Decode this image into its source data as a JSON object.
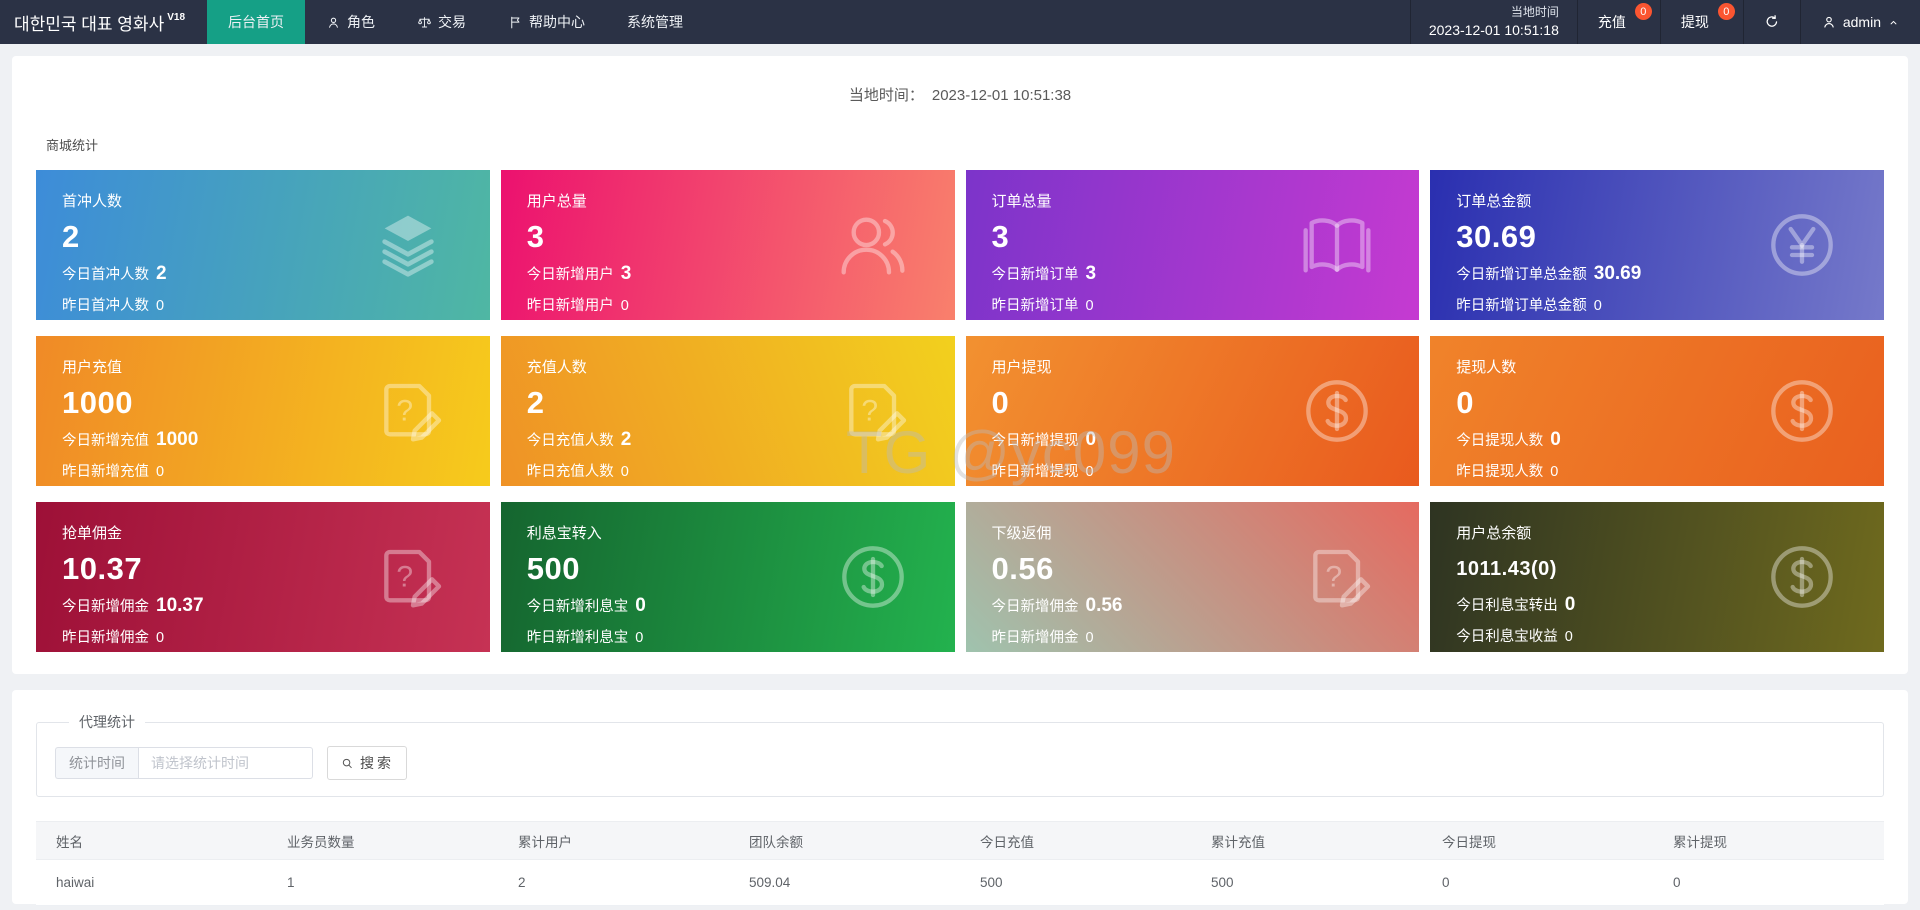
{
  "topbar": {
    "brand": "대한민국 대표 영화사",
    "brand_version": "V18",
    "nav": [
      {
        "label": "后台首页",
        "icon": "none",
        "active": true
      },
      {
        "label": "角色",
        "icon": "user",
        "active": false
      },
      {
        "label": "交易",
        "icon": "scales",
        "active": false
      },
      {
        "label": "帮助中心",
        "icon": "flag",
        "active": false
      },
      {
        "label": "系统管理",
        "icon": "none",
        "active": false
      }
    ],
    "local_time_label": "当地时间",
    "local_time_value": "2023-12-01 10:51:18",
    "recharge": {
      "label": "充值",
      "badge": "0"
    },
    "withdraw": {
      "label": "提现",
      "badge": "0"
    },
    "username": "admin"
  },
  "overview": {
    "time_label": "当地时间：",
    "time_value": "2023-12-01 10:51:38",
    "section_title": "商城统计",
    "watermark": "TG @yc099",
    "cards": [
      {
        "title": "首冲人数",
        "value": "2",
        "line2_label": "今日首冲人数",
        "line2_value": "2",
        "line3_label": "昨日首冲人数",
        "line3_value": "0",
        "icon": "layers",
        "angle": 100,
        "colors": [
          "#3d8cd9",
          "#4fb7a3"
        ]
      },
      {
        "title": "用户总量",
        "value": "3",
        "line2_label": "今日新增用户",
        "line2_value": "3",
        "line3_label": "昨日新增用户",
        "line3_value": "0",
        "icon": "users",
        "angle": 100,
        "colors": [
          "#ec116f",
          "#f9806c"
        ]
      },
      {
        "title": "订单总量",
        "value": "3",
        "line2_label": "今日新增订单",
        "line2_value": "3",
        "line3_label": "昨日新增订单",
        "line3_value": "0",
        "icon": "book",
        "angle": 100,
        "colors": [
          "#7c34ca",
          "#c53ad1"
        ]
      },
      {
        "title": "订单总金额",
        "value": "30.69",
        "line2_label": "今日新增订单总金额",
        "line2_value": "30.69",
        "line3_label": "昨日新增订单总金额",
        "line3_value": "0",
        "icon": "yen",
        "angle": 100,
        "colors": [
          "#2a2fb0",
          "#7579ca"
        ]
      },
      {
        "title": "用户充值",
        "value": "1000",
        "line2_label": "今日新增充值",
        "line2_value": "1000",
        "line3_label": "昨日新增充值",
        "line3_value": "0",
        "icon": "doc",
        "angle": 100,
        "colors": [
          "#f08a27",
          "#f6cb1c"
        ]
      },
      {
        "title": "充值人数",
        "value": "2",
        "line2_label": "今日充值人数",
        "line2_value": "2",
        "line3_label": "昨日充值人数",
        "line3_value": "0",
        "icon": "doc",
        "angle": 70,
        "colors": [
          "#ef9226",
          "#f2d01e"
        ]
      },
      {
        "title": "用户提现",
        "value": "0",
        "line2_label": "今日新增提现",
        "line2_value": "0",
        "line3_label": "昨日新增提现",
        "line3_value": "0",
        "icon": "dollar",
        "angle": 115,
        "colors": [
          "#f29130",
          "#e95a1e"
        ]
      },
      {
        "title": "提现人数",
        "value": "0",
        "line2_label": "今日提现人数",
        "line2_value": "0",
        "line3_label": "昨日提现人数",
        "line3_value": "0",
        "icon": "dollar",
        "angle": 115,
        "colors": [
          "#f0832a",
          "#e9601f"
        ]
      },
      {
        "title": "抢单佣金",
        "value": "10.37",
        "line2_label": "今日新增佣金",
        "line2_value": "10.37",
        "line3_label": "昨日新增佣金",
        "line3_value": "0",
        "icon": "doc",
        "angle": 100,
        "colors": [
          "#9d1037",
          "#c63254"
        ]
      },
      {
        "title": "利息宝转入",
        "value": "500",
        "line2_label": "今日新增利息宝",
        "line2_value": "0",
        "line3_label": "昨日新增利息宝",
        "line3_value": "0",
        "icon": "dollar",
        "angle": 100,
        "colors": [
          "#15652f",
          "#23b24e"
        ]
      },
      {
        "title": "下级返佣",
        "value": "0.56",
        "line2_label": "今日新增佣金",
        "line2_value": "0.56",
        "line3_label": "昨日新增佣金",
        "line3_value": "0",
        "icon": "doc",
        "angle": 45,
        "colors": [
          "#9fc3ae",
          "#e56a60"
        ]
      },
      {
        "title": "用户总余额",
        "value": "1011.43(0)",
        "small_value": true,
        "line2_label": "今日利息宝转出",
        "line2_value": "0",
        "line3_label": "今日利息宝收益",
        "line3_value": "0",
        "icon": "dollar",
        "angle": 100,
        "colors": [
          "#2e3422",
          "#6f6a1e"
        ]
      }
    ]
  },
  "agent": {
    "legend": "代理统计",
    "filter_label": "统计时间",
    "filter_placeholder": "请选择统计时间",
    "search_label": "搜索",
    "table": {
      "headers": [
        "姓名",
        "业务员数量",
        "累计用户",
        "团队余额",
        "今日充值",
        "累计充值",
        "今日提现",
        "累计提现"
      ],
      "rows": [
        [
          "haiwai",
          "1",
          "2",
          "509.04",
          "500",
          "500",
          "0",
          "0"
        ]
      ]
    }
  },
  "colors": {
    "topbar_bg": "#2b3245",
    "active_tab": "#15a086",
    "badge": "#fb5531",
    "page_bg": "#eff1f4"
  }
}
